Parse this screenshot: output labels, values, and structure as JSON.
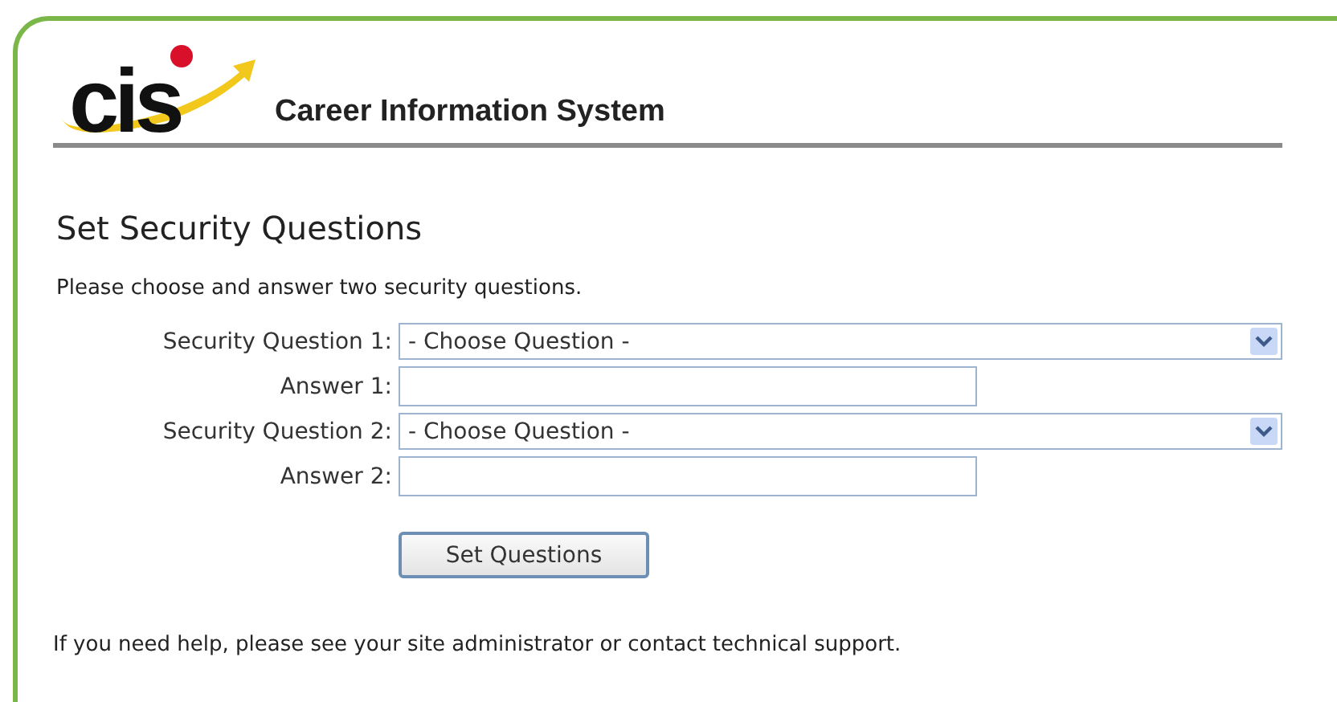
{
  "header": {
    "logo_text": "cis",
    "title": "Career Information System"
  },
  "page_title": "Set Security Questions",
  "instructions": "Please choose and answer two security questions.",
  "form": {
    "rows": [
      {
        "kind": "select",
        "label": "Security Question 1:",
        "value": "- Choose Question -"
      },
      {
        "kind": "text",
        "label": "Answer 1:"
      },
      {
        "kind": "select",
        "label": "Security Question 2:",
        "value": "- Choose Question -"
      },
      {
        "kind": "text",
        "label": "Answer 2:"
      }
    ],
    "submit": "Set Questions"
  },
  "help_text": "If you need help, please see your site administrator or contact technical support."
}
